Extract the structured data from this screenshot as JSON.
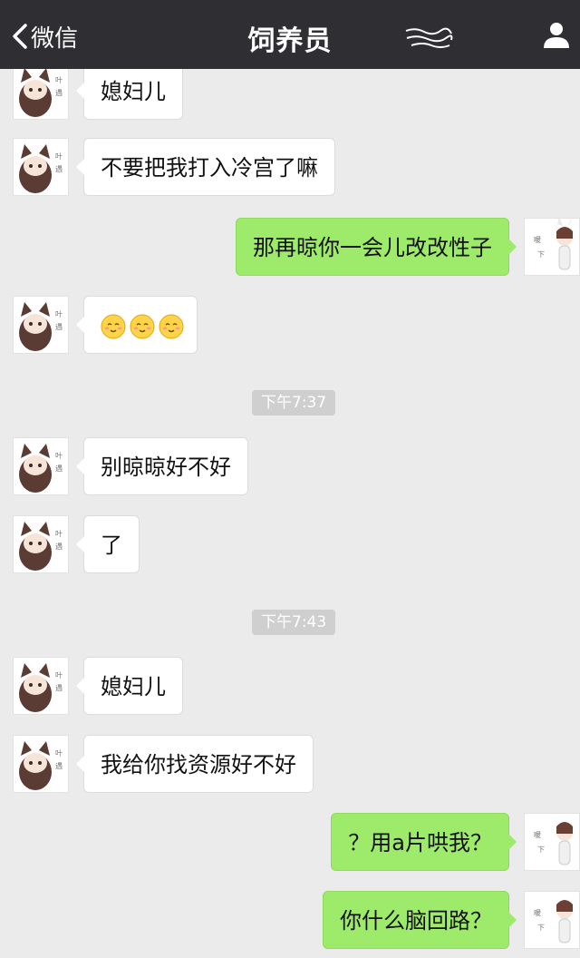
{
  "nav": {
    "back_label": "微信",
    "title": "饲养员"
  },
  "messages": [
    {
      "side": "in",
      "text": "媳妇儿"
    },
    {
      "side": "in",
      "text": "不要把我打入冷宫了嘛"
    },
    {
      "side": "out",
      "text": "那再晾你一会儿改改性子"
    },
    {
      "side": "in",
      "emoji": [
        "smile-emoji",
        "smile-emoji",
        "smile-emoji"
      ]
    },
    {
      "time": "下午7:37"
    },
    {
      "side": "in",
      "text": "别晾晾好不好"
    },
    {
      "side": "in",
      "text": "了"
    },
    {
      "time": "下午7:43"
    },
    {
      "side": "in",
      "text": "媳妇儿"
    },
    {
      "side": "in",
      "text": "我给你找资源好不好"
    },
    {
      "side": "out",
      "text": "？用a片哄我？"
    },
    {
      "side": "out",
      "text": "你什么脑回路？"
    }
  ],
  "colors": {
    "nav_bg": "#2e2e33",
    "chat_bg": "#ebebeb",
    "incoming_bubble": "#ffffff",
    "outgoing_bubble": "#9eea6a"
  },
  "icons": {
    "back": "chevron-left-icon",
    "profile": "person-icon",
    "scribble": "scribble-icon"
  }
}
